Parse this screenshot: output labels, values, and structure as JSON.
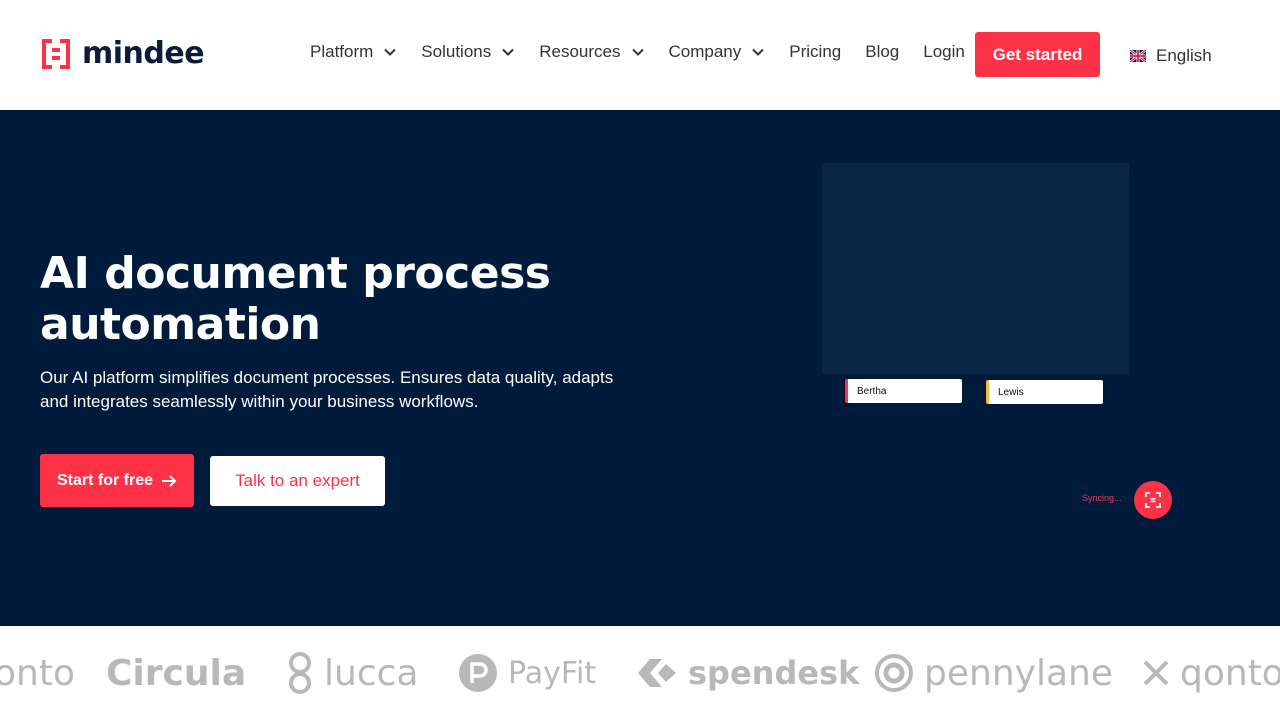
{
  "brand": {
    "name": "mindee",
    "accent": "#fd3246",
    "dark": "#001b3b"
  },
  "nav": {
    "items": [
      {
        "label": "Platform",
        "dropdown": true
      },
      {
        "label": "Solutions",
        "dropdown": true
      },
      {
        "label": "Resources",
        "dropdown": true
      },
      {
        "label": "Company",
        "dropdown": true
      },
      {
        "label": "Pricing",
        "dropdown": false
      },
      {
        "label": "Blog",
        "dropdown": false
      },
      {
        "label": "Login",
        "dropdown": false
      }
    ],
    "cta_label": "Get started",
    "language": "English",
    "language_icon": "uk-flag-icon"
  },
  "hero": {
    "title": "AI document process automation",
    "subtitle": "Our AI platform simplifies document processes. Ensures data quality, adapts and integrates seamlessly within your business workflows.",
    "primary_cta": "Start for free",
    "secondary_cta": "Talk to an expert",
    "tags": [
      "Bertha",
      "Lewis"
    ],
    "sync_status": "Syncing..."
  },
  "partners": [
    "onto",
    "Circula",
    "lucca",
    "PayFit",
    "spendesk",
    "pennylane",
    "qonto"
  ]
}
